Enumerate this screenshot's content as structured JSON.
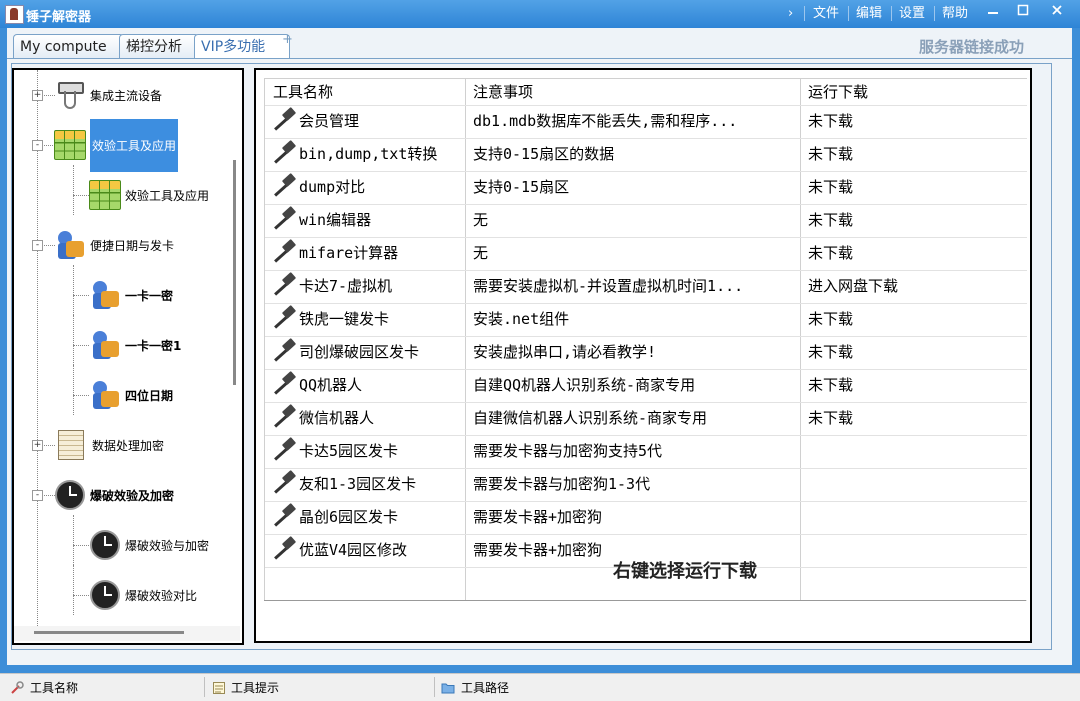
{
  "window": {
    "title": "锤子解密器",
    "menu": [
      "文件",
      "编辑",
      "设置",
      "帮助"
    ],
    "chevron": "›",
    "controls": [
      "minimize-icon",
      "maximize-icon",
      "close-icon"
    ]
  },
  "tabs": [
    {
      "label": "My compute",
      "active": false
    },
    {
      "label": "梯控分析",
      "active": false
    },
    {
      "label": "VIP多功能",
      "active": true
    }
  ],
  "tab_add": "+",
  "connection_status": "服务器链接成功",
  "tree": [
    {
      "label": "集成主流设备",
      "icon": "usb-cable-icon",
      "level": 0,
      "expander": "+",
      "selected": false,
      "bold": false
    },
    {
      "label": "效验工具及应用",
      "icon": "spreadsheet-icon",
      "level": 0,
      "expander": "-",
      "selected": true,
      "bold": false
    },
    {
      "label": "效验工具及应用",
      "icon": "spreadsheet-icon",
      "level": 1,
      "expander": "",
      "selected": false,
      "bold": false
    },
    {
      "label": "便捷日期与发卡",
      "icon": "users-icon",
      "level": 0,
      "expander": "-",
      "selected": false,
      "bold": false
    },
    {
      "label": "一卡一密",
      "icon": "users-icon",
      "level": 1,
      "expander": "",
      "selected": false,
      "bold": true
    },
    {
      "label": "一卡一密1",
      "icon": "users-icon",
      "level": 1,
      "expander": "",
      "selected": false,
      "bold": true
    },
    {
      "label": "四位日期",
      "icon": "users-icon",
      "level": 1,
      "expander": "",
      "selected": false,
      "bold": true
    },
    {
      "label": "数据处理加密",
      "icon": "document-icon",
      "level": 0,
      "expander": "+",
      "selected": false,
      "bold": false
    },
    {
      "label": "爆破效验及加密",
      "icon": "clock-icon",
      "level": 0,
      "expander": "-",
      "selected": false,
      "bold": true
    },
    {
      "label": "爆破效验与加密",
      "icon": "clock-icon",
      "level": 1,
      "expander": "",
      "selected": false,
      "bold": false
    },
    {
      "label": "爆破效验对比",
      "icon": "clock-icon",
      "level": 1,
      "expander": "",
      "selected": false,
      "bold": false
    }
  ],
  "table": {
    "headers": [
      "工具名称",
      "注意事项",
      "运行下载"
    ],
    "rows": [
      [
        "会员管理",
        "db1.mdb数据库不能丢失,需和程序...",
        "未下载"
      ],
      [
        "bin,dump,txt转换",
        "支持0-15扇区的数据",
        "未下载"
      ],
      [
        "dump对比",
        "支持0-15扇区",
        "未下载"
      ],
      [
        "win编辑器",
        "无",
        "未下载"
      ],
      [
        "mifare计算器",
        "无",
        "未下载"
      ],
      [
        "卡达7-虚拟机",
        "需要安装虚拟机-并设置虚拟机时间1...",
        "进入网盘下载"
      ],
      [
        "铁虎一键发卡",
        "安装.net组件",
        "未下载"
      ],
      [
        "司创爆破园区发卡",
        "安装虚拟串口,请必看教学!",
        "未下载"
      ],
      [
        "QQ机器人",
        "自建QQ机器人识别系统-商家专用",
        "未下载"
      ],
      [
        "微信机器人",
        "自建微信机器人识别系统-商家专用",
        "未下载"
      ],
      [
        "卡达5园区发卡",
        "需要发卡器与加密狗支持5代",
        ""
      ],
      [
        "友和1-3园区发卡",
        "需要发卡器与加密狗1-3代",
        ""
      ],
      [
        "晶创6园区发卡",
        "需要发卡器+加密狗",
        ""
      ],
      [
        "优蓝V4园区修改",
        "需要发卡器+加密狗",
        ""
      ]
    ],
    "row_icon": "hammer-icon",
    "hint": "右键选择运行下载"
  },
  "statusbar": [
    {
      "label": "工具名称",
      "icon": "tool-icon"
    },
    {
      "label": "工具提示",
      "icon": "notepad-icon"
    },
    {
      "label": "工具路径",
      "icon": "folder-icon"
    }
  ]
}
